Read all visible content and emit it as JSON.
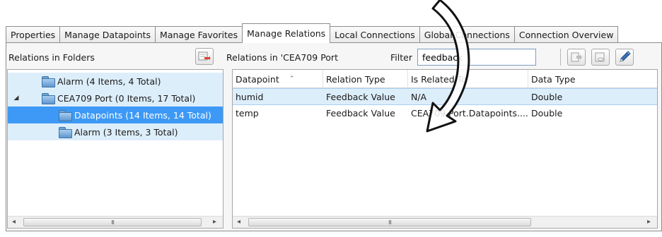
{
  "tabs": [
    {
      "label": "Properties"
    },
    {
      "label": "Manage Datapoints"
    },
    {
      "label": "Manage Favorites"
    },
    {
      "label": "Manage Relations"
    },
    {
      "label": "Local Connections"
    },
    {
      "label": "Global Connections"
    },
    {
      "label": "Connection Overview"
    }
  ],
  "active_tab": "Manage Relations",
  "left_pane": {
    "title": "Relations in Folders",
    "add_button_icon": "add-relation-icon",
    "tree": [
      {
        "label": "Alarm (4 Items, 4 Total)",
        "level": 1,
        "expander": ""
      },
      {
        "label": "CEA709 Port (0 Items, 17 Total)",
        "level": 1,
        "expander": "◢"
      },
      {
        "label": "Datapoints (14 Items, 14 Total)",
        "level": 2,
        "selected": true
      },
      {
        "label": "Alarm (3 Items, 3 Total)",
        "level": 2
      }
    ],
    "scroll_left": "◂",
    "scroll_right": "▸",
    "scroll_grip": "III"
  },
  "right_pane": {
    "title": "Relations in 'CEA709 Port",
    "filter_label": "Filter",
    "filter_value": "feedback",
    "toolbar_icons": [
      "export-icon",
      "link-icon",
      "edit-icon"
    ],
    "columns": [
      "Datapoint",
      "Relation Type",
      "Is Related To",
      "Data Type"
    ],
    "sort_indicator": "⌃",
    "rows": [
      {
        "datapoint": "humid",
        "relation_type": "Feedback Value",
        "related_to": "N/A",
        "data_type": "Double"
      },
      {
        "datapoint": "temp",
        "relation_type": "Feedback Value",
        "related_to": "CEA709 Port.Datapoints....",
        "data_type": "Double"
      }
    ],
    "scroll_left": "◂",
    "scroll_right": "▸",
    "scroll_grip": "III"
  },
  "colors": {
    "selection": "#3d99f5",
    "selection_light": "#ddeefb",
    "accent": "#7a9cc3"
  }
}
